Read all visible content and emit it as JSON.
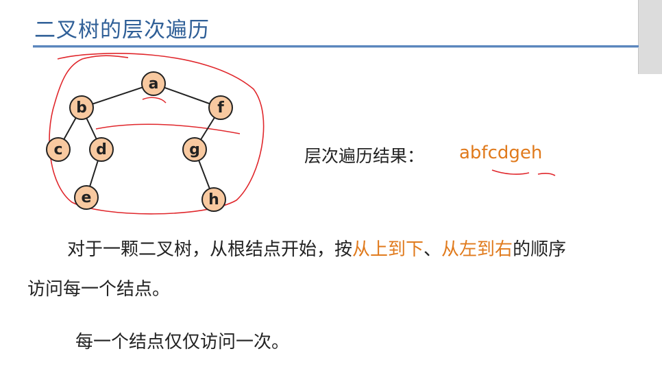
{
  "title": "二叉树的层次遍历",
  "colors": {
    "title": "#2f5f97",
    "highlight": "#e07a1c",
    "node_fill": "#f8c9a0",
    "ink_annotation": "#e0262b"
  },
  "tree": {
    "nodes": [
      "a",
      "b",
      "f",
      "c",
      "d",
      "g",
      "e",
      "h"
    ],
    "edges": [
      [
        "a",
        "b"
      ],
      [
        "a",
        "f"
      ],
      [
        "b",
        "c"
      ],
      [
        "b",
        "d"
      ],
      [
        "d",
        "e"
      ],
      [
        "f",
        "g"
      ],
      [
        "g",
        "h"
      ]
    ]
  },
  "result": {
    "label": "层次遍历结果：",
    "value": "abfcdgeh"
  },
  "paragraph1": {
    "part1": "对于一颗二叉树，从根结点开始，按",
    "hl1": "从上到下",
    "sep": "、",
    "hl2": "从左到右",
    "part2": "的顺序",
    "line2": "访问每一个结点。"
  },
  "paragraph2": "每一个结点仅仅访问一次。"
}
